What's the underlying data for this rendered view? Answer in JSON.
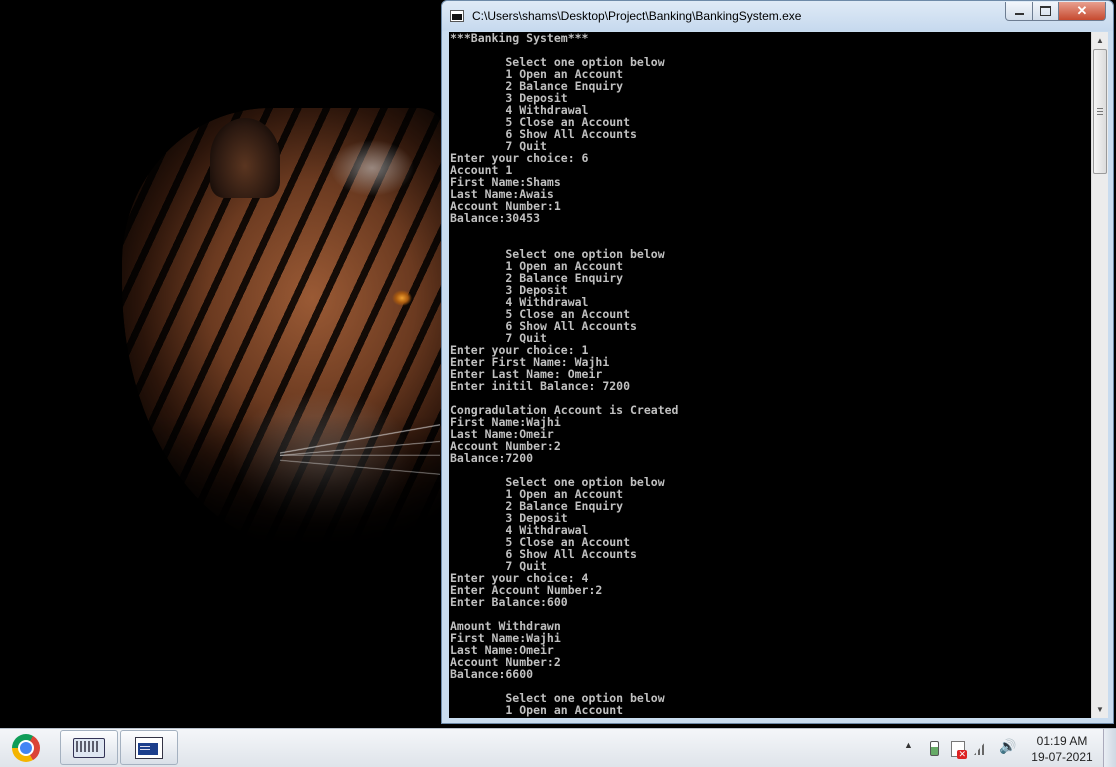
{
  "window": {
    "title": "C:\\Users\\shams\\Desktop\\Project\\Banking\\BankingSystem.exe",
    "minimize_icon": "minimize-icon",
    "maximize_icon": "maximize-icon",
    "close_icon": "close-icon"
  },
  "console": {
    "lines": [
      "***Banking System***",
      "",
      "        Select one option below",
      "        1 Open an Account",
      "        2 Balance Enquiry",
      "        3 Deposit",
      "        4 Withdrawal",
      "        5 Close an Account",
      "        6 Show All Accounts",
      "        7 Quit",
      "Enter your choice: 6",
      "Account 1",
      "First Name:Shams",
      "Last Name:Awais",
      "Account Number:1",
      "Balance:30453",
      "",
      "",
      "        Select one option below",
      "        1 Open an Account",
      "        2 Balance Enquiry",
      "        3 Deposit",
      "        4 Withdrawal",
      "        5 Close an Account",
      "        6 Show All Accounts",
      "        7 Quit",
      "Enter your choice: 1",
      "Enter First Name: Wajhi",
      "Enter Last Name: Omeir",
      "Enter initil Balance: 7200",
      "",
      "Congradulation Account is Created",
      "First Name:Wajhi",
      "Last Name:Omeir",
      "Account Number:2",
      "Balance:7200",
      "",
      "        Select one option below",
      "        1 Open an Account",
      "        2 Balance Enquiry",
      "        3 Deposit",
      "        4 Withdrawal",
      "        5 Close an Account",
      "        6 Show All Accounts",
      "        7 Quit",
      "Enter your choice: 4",
      "Enter Account Number:2",
      "Enter Balance:600",
      "",
      "Amount Withdrawn",
      "First Name:Wajhi",
      "Last Name:Omeir",
      "Account Number:2",
      "Balance:6600",
      "",
      "        Select one option below",
      "        1 Open an Account"
    ],
    "text_color": "#c0c0c0",
    "background": "#000000"
  },
  "scrollbar": {
    "up_icon": "scroll-up-arrow-icon",
    "down_icon": "scroll-down-arrow-icon"
  },
  "taskbar": {
    "pinned": [
      {
        "icon": "chrome-icon"
      },
      {
        "icon": "on-screen-keyboard-icon"
      },
      {
        "icon": "console-app-icon"
      }
    ],
    "tray": {
      "icons": [
        "show-hidden-icons-icon",
        "battery-icon",
        "action-center-flag-icon",
        "network-icon",
        "volume-icon"
      ],
      "time": "01:19 AM",
      "date": "19-07-2021"
    }
  }
}
